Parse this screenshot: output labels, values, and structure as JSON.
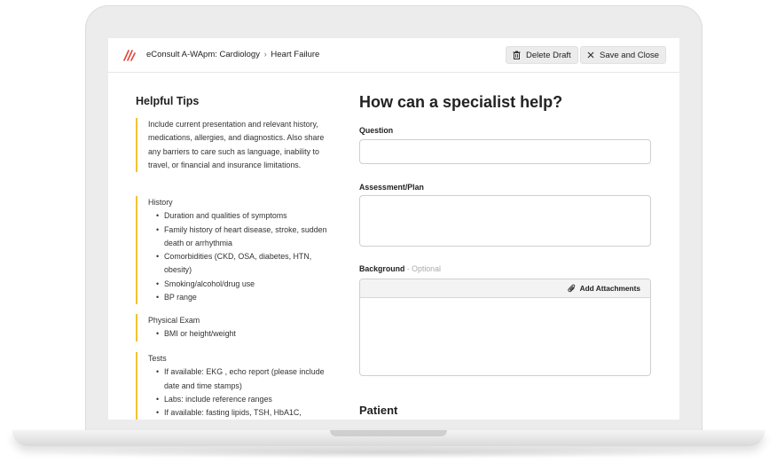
{
  "header": {
    "breadcrumb_main": "eConsult A-WApm: Cardiology",
    "breadcrumb_sep": "›",
    "breadcrumb_sub": "Heart Failure",
    "delete_label": "Delete Draft",
    "close_label": "Save and Close"
  },
  "tips": {
    "title": "Helpful Tips",
    "intro": "Include current presentation and relevant history, medications, allergies, and diagnostics. Also share any barriers to care such as language, inability to travel, or financial and insurance limitations.",
    "history": {
      "heading": "History",
      "items": [
        "Duration and qualities of symptoms",
        "Family history of heart disease, stroke, sudden death or arrhythmia",
        "Comorbidities (CKD, OSA, diabetes, HTN, obesity)",
        "Smoking/alcohol/drug use",
        "BP range"
      ]
    },
    "exam": {
      "heading": "Physical Exam",
      "items": [
        "BMI or height/weight"
      ]
    },
    "tests": {
      "heading": "Tests",
      "items": [
        "If available: EKG , echo report (please include date and time stamps)",
        "Labs: include reference ranges",
        "If available: fasting lipids, TSH, HbA1C,"
      ]
    }
  },
  "form": {
    "title": "How can a specialist help?",
    "question_label": "Question",
    "question_value": "",
    "assessment_label": "Assessment/Plan",
    "assessment_value": "",
    "background_label": "Background",
    "background_optional": "- Optional",
    "background_value": "",
    "attach_label": "Add Attachments",
    "patient_heading": "Patient"
  },
  "icons": {
    "logo": "logo-icon",
    "delete": "trash-icon",
    "close": "close-icon",
    "attach": "paperclip-icon"
  },
  "colors": {
    "brand": "#e0453a",
    "tip_accent": "#f1c232"
  }
}
